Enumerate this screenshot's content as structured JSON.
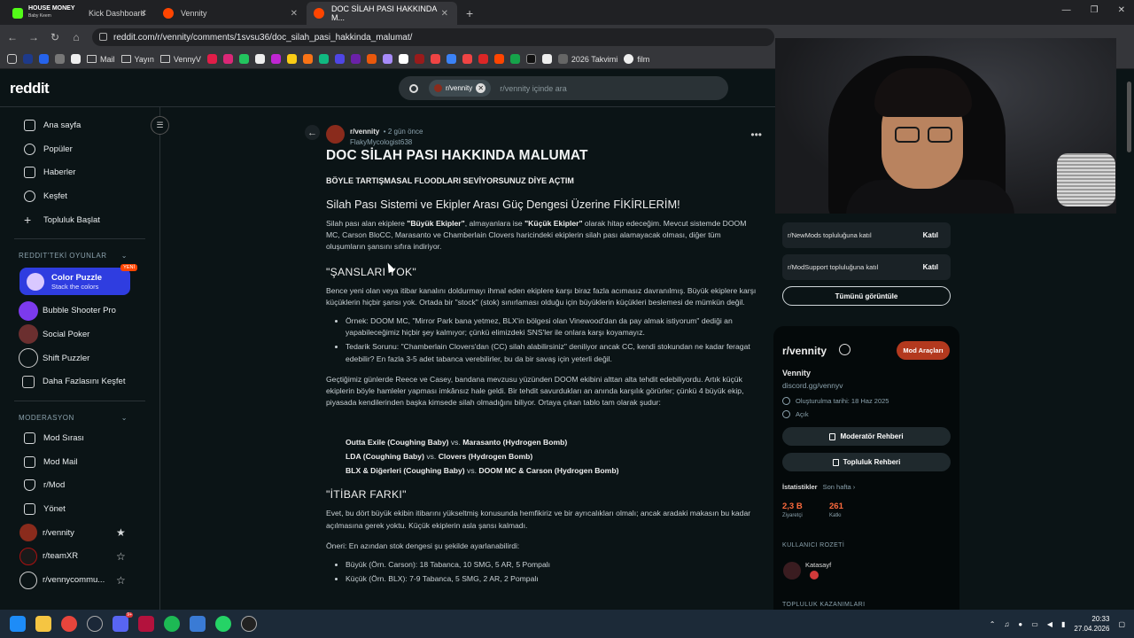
{
  "browser": {
    "tabs": [
      {
        "title": "Kick Dashboard",
        "icon": "kick-icon",
        "color": "#53fc18"
      },
      {
        "title": "Vennity",
        "icon": "reddit-icon",
        "color": "#ff4500"
      },
      {
        "title": "DOC SİLAH PASI HAKKINDA M...",
        "icon": "reddit-icon",
        "color": "#ff4500"
      }
    ],
    "overlay_title": "HOUSE MONEY",
    "overlay_sub": "Baby Keem",
    "url": "reddit.com/r/vennity/comments/1svsu36/doc_silah_pasi_hakkinda_malumat/",
    "bookmarks": [
      "Mail",
      "Yayın",
      "VennyV",
      "2026 Takvimi",
      "film"
    ]
  },
  "reddit": {
    "logo": "reddit",
    "search_chip": "r/vennity",
    "search_placeholder": "r/vennity içinde ara"
  },
  "sidebar": {
    "nav": [
      "Ana sayfa",
      "Popüler",
      "Haberler",
      "Keşfet",
      "Topluluk Başlat"
    ],
    "games_header": "REDDIT'TEKİ OYUNLAR",
    "featured_game": {
      "title": "Color Puzzle",
      "subtitle": "Stack the colors",
      "badge": "YENİ"
    },
    "games": [
      "Bubble Shooter Pro",
      "Social Poker",
      "Shift Puzzler",
      "Daha Fazlasını Keşfet"
    ],
    "mod_header": "MODERASYON",
    "mod": [
      "Mod Sırası",
      "Mod Mail",
      "r/Mod",
      "Yönet"
    ],
    "communities": [
      "r/vennity",
      "r/teamXR",
      "r/vennycommu..."
    ]
  },
  "post": {
    "subreddit": "r/vennity",
    "age": "• 2 gün önce",
    "author": "FlakyMycologist638",
    "title": "DOC SİLAH PASI HAKKINDA MALUMAT",
    "subtitle": "BÖYLE TARTIŞMASAL FLOODLARI SEVİYORSUNUZ DİYE AÇTIM",
    "h_system": "Silah Pası Sistemi ve Ekipler Arası Güç Dengesi Üzerine FİKİRLERİM!",
    "p1_a": "Silah pası alan ekiplere ",
    "p1_big": "\"Büyük Ekipler\"",
    "p1_b": ", almayanlara ise ",
    "p1_small": "\"Küçük Ekipler\"",
    "p1_c": " olarak hitap edeceğim. Mevcut sistemde DOOM MC, Carson BloCC, Marasanto ve Chamberlain Clovers haricindeki ekiplerin silah pası alamayacak olması, diğer tüm oluşumların şansını sıfıra indiriyor.",
    "h_chance": "\"ŞANSLARI YOK\"",
    "p2": "Bence yeni olan veya itibar kanalını doldurmayı ihmal eden ekiplere karşı biraz fazla acımasız davranılmış. Büyük ekiplere karşı küçüklerin hiçbir şansı yok. Ortada bir \"stock\" (stok) sınırlaması olduğu için büyüklerin küçükleri beslemesi de mümkün değil.",
    "bullets1": [
      "Örnek: DOOM MC, \"Mirror Park bana yetmez, BLX'in bölgesi olan Vinewood'dan da pay almak istiyorum\" dediği an yapabileceğimiz hiçbir şey kalmıyor; çünkü elimizdeki SNS'ler ile onlara karşı koyamayız.",
      "Tedarik Sorunu: \"Chamberlain Clovers'dan (CC) silah alabilirsiniz\" deniliyor ancak CC, kendi stokundan ne kadar feragat edebilir? En fazla 3-5 adet tabanca verebilirler, bu da bir savaş için yeterli değil."
    ],
    "p3": "Geçtiğimiz günlerde Reece ve Casey, bandana mevzusu yüzünden DOOM ekibini alttan alta tehdit edebiliyordu. Artık küçük ekiplerin böyle hamleler yapması imkânsız hale geldi. Bir tehdit savurdukları an anında karşılık görürler; çünkü 4 büyük ekip, piyasada kendilerinden başka kimsede silah olmadığını biliyor. Ortaya çıkan tablo tam olarak şudur:",
    "matchups": [
      {
        "a": "Outta Exile (Coughing Baby)",
        "vs": " vs. ",
        "b": "Marasanto (Hydrogen Bomb)"
      },
      {
        "a": "LDA (Coughing Baby)",
        "vs": " vs. ",
        "b": "Clovers (Hydrogen Bomb)"
      },
      {
        "a": "BLX & Diğerleri (Coughing Baby)",
        "vs": " vs. ",
        "b": "DOOM MC & Carson (Hydrogen Bomb)"
      }
    ],
    "h_rep": "\"İTİBAR FARKI\"",
    "p4": "Evet, bu dört büyük ekibin itibarını yükseltmiş konusunda hemfikiriz ve bir ayrıcalıkları olmalı; ancak aradaki makasın bu kadar açılmasına gerek yoktu. Küçük ekiplerin asla şansı kalmadı.",
    "p5": "Öneri: En azından stok dengesi şu şekilde ayarlanabilirdi:",
    "bullets2": [
      "Büyük (Örn. Carson): 18 Tabanca, 10 SMG, 5 AR, 5 Pompalı",
      "Küçük (Örn. BLX): 7-9 Tabanca, 5 SMG, 2 AR, 2 Pompalı"
    ]
  },
  "right": {
    "join1": "r/NewMods topluluğuna katıl",
    "join2": "r/ModSupport topluluğuna katıl",
    "join_btn": "Katıl",
    "all_btn": "Tümünü görüntüle",
    "sub_name": "r/vennity",
    "mod_tools": "Mod Araçları",
    "title": "Vennity",
    "discord": "discord.gg/vennyv",
    "created": "Oluşturulma tarihi: 18 Haz 2025",
    "visibility": "Açık",
    "mod_guide": "Moderatör Rehberi",
    "community_guide": "Topluluk Rehberi",
    "stats_label": "İstatistikler",
    "stats_period": "Son hafta ›",
    "visitors_value": "2,3 B",
    "visitors_label": "Ziyaretçi",
    "contrib_value": "261",
    "contrib_label": "Katkı",
    "badge_header": "KULLANICI ROZETİ",
    "badge_user": "Katasayf",
    "achievements_header": "TOPLULUK KAZANIMLARI"
  },
  "taskbar": {
    "time": "20:33",
    "date": "27.04.2026",
    "notif_count": "9+"
  }
}
